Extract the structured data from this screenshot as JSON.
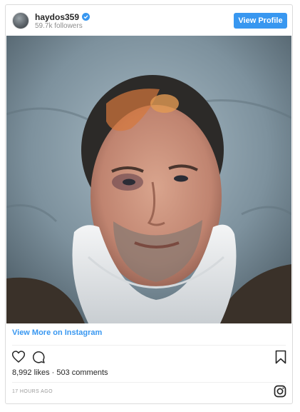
{
  "post": {
    "username": "haydos359",
    "verified_icon": "verified-badge-icon",
    "followers": "59.7k followers",
    "view_profile_label": "View Profile",
    "photo_alt": "selfie",
    "view_more_label": "View More on Instagram",
    "likes_text": "8,992 likes · 503 comments",
    "timestamp": "17 HOURS AGO"
  },
  "icons": {
    "avatar": "avatar",
    "like": "heart-icon",
    "comment": "comment-icon",
    "save": "bookmark-icon",
    "instagram": "instagram-icon"
  },
  "colors": {
    "accent": "#3897f0",
    "text": "#262626",
    "muted": "#8e8e8e"
  }
}
